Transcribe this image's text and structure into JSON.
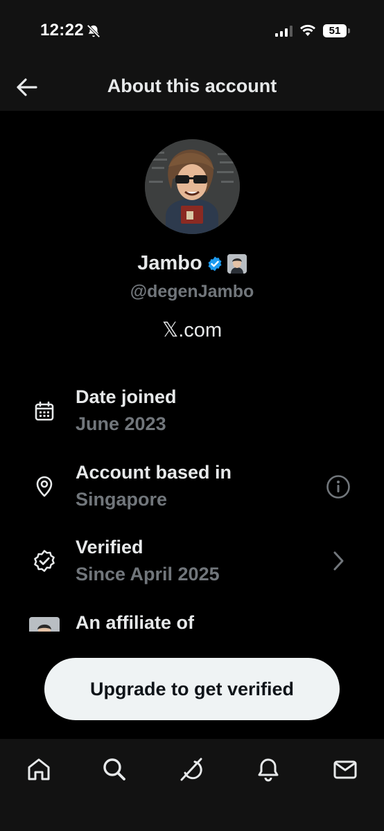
{
  "status_bar": {
    "time": "12:22",
    "battery": "51",
    "icons": [
      "bell-off-icon",
      "signal-icon",
      "wifi-icon",
      "battery-icon"
    ]
  },
  "header": {
    "title": "About this account",
    "back_icon": "back-arrow-icon"
  },
  "profile": {
    "display_name": "Jambo",
    "handle": "@degenJambo",
    "site": "𝕏.com",
    "badges": [
      "verified-badge-icon",
      "affiliate-badge"
    ],
    "colors": {
      "verified": "#1d9bf0"
    }
  },
  "details": [
    {
      "icon": "calendar-icon",
      "label": "Date joined",
      "value": "June 2023"
    },
    {
      "icon": "location-pin-icon",
      "label": "Account based in",
      "value": "Singapore",
      "action_icon": "info-icon"
    },
    {
      "icon": "verified-check-icon",
      "label": "Verified",
      "value": "Since April 2025",
      "action_icon": "chevron-right-icon"
    },
    {
      "icon": "affiliate-avatar",
      "label": "An affiliate of"
    }
  ],
  "cta": {
    "label": "Upgrade to get verified"
  },
  "bottom_nav": {
    "items": [
      "home-icon",
      "search-icon",
      "grok-icon",
      "notifications-icon",
      "messages-icon"
    ]
  },
  "colors": {
    "background": "#000000",
    "header_background": "#121212",
    "primary_text": "#e7e9ea",
    "secondary_text": "#71767b",
    "button_background": "#eff3f4"
  }
}
